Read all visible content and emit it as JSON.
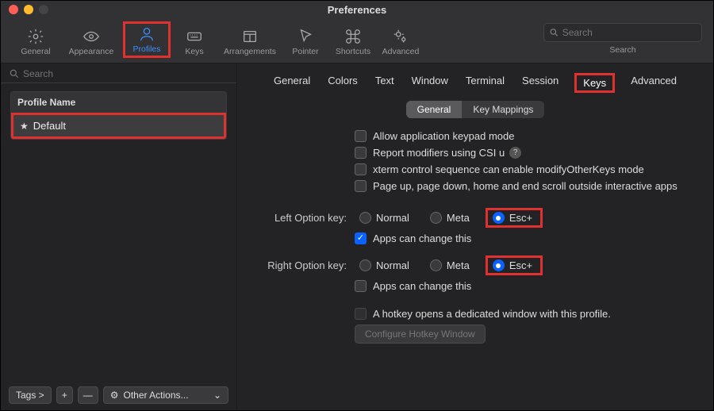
{
  "window": {
    "title": "Preferences"
  },
  "toolbar": {
    "items": [
      {
        "id": "general",
        "label": "General"
      },
      {
        "id": "appearance",
        "label": "Appearance"
      },
      {
        "id": "profiles",
        "label": "Profiles"
      },
      {
        "id": "keys",
        "label": "Keys"
      },
      {
        "id": "arrangements",
        "label": "Arrangements"
      },
      {
        "id": "pointer",
        "label": "Pointer"
      },
      {
        "id": "shortcuts",
        "label": "Shortcuts"
      },
      {
        "id": "advanced",
        "label": "Advanced"
      }
    ],
    "selected": "profiles",
    "search_placeholder": "Search",
    "search_label": "Search"
  },
  "sidebar": {
    "search_placeholder": "Search",
    "header": "Profile Name",
    "profiles": [
      {
        "name": "Default",
        "starred": true
      }
    ],
    "footer": {
      "tags": "Tags >",
      "add": "+",
      "remove": "—",
      "other_actions": "Other Actions..."
    }
  },
  "tabs": {
    "items": [
      "General",
      "Colors",
      "Text",
      "Window",
      "Terminal",
      "Session",
      "Keys",
      "Advanced"
    ],
    "selected": "Keys"
  },
  "subtabs": {
    "items": [
      "General",
      "Key Mappings"
    ],
    "selected": "General"
  },
  "keys": {
    "cb_keypad": "Allow application keypad mode",
    "cb_csi": "Report modifiers using CSI u",
    "cb_xterm": "xterm control sequence can enable modifyOtherKeys mode",
    "cb_pagescroll": "Page up, page down, home and end scroll outside interactive apps",
    "left_label": "Left Option key:",
    "right_label": "Right Option key:",
    "opt_normal": "Normal",
    "opt_meta": "Meta",
    "opt_esc": "Esc+",
    "apps_change": "Apps can change this",
    "hotkey_label": "A hotkey opens a dedicated window with this profile.",
    "configure_btn": "Configure Hotkey Window"
  }
}
